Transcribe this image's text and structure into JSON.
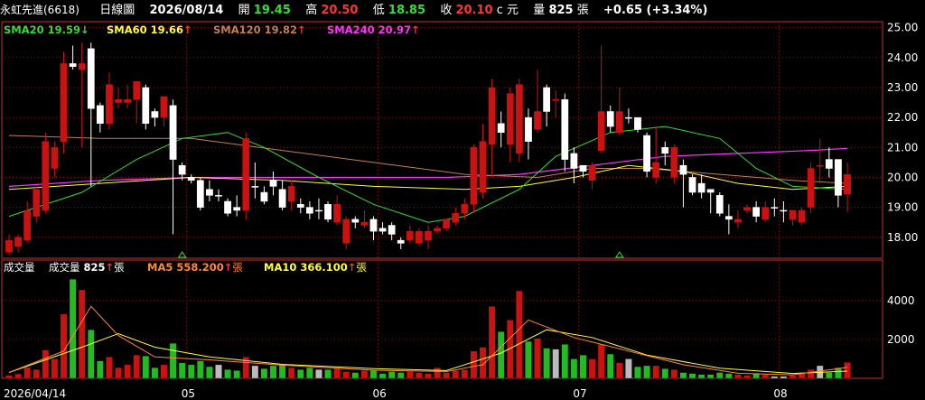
{
  "header": {
    "stock_name": "永虹先進(6618)",
    "chart_type": "日線圖",
    "date": "2026/08/14",
    "open_label": "開",
    "open": "19.45",
    "high_label": "高",
    "high": "20.50",
    "low_label": "低",
    "low": "18.85",
    "close_label": "收",
    "close": "20.10",
    "currency": "c 元",
    "volume_label": "量",
    "volume": "825",
    "volume_unit": "張",
    "change": "+0.65 (+3.34%)"
  },
  "ma_legend": [
    {
      "label": "SMA20 19.59",
      "arrow": "↓",
      "color": "#33dd33"
    },
    {
      "label": "SMA60 19.66",
      "arrow": "↑",
      "color": "#ffff33"
    },
    {
      "label": "SMA120 19.82",
      "arrow": "↑",
      "color": "#c08050"
    },
    {
      "label": "SMA240 20.97",
      "arrow": "↑",
      "color": "#ff33ff"
    }
  ],
  "volume_legend": {
    "title": "成交量",
    "vol_label": "成交量",
    "vol_value": "825",
    "vol_unit": "張",
    "ma5_label": "MA5 558.200",
    "ma5_unit": "張",
    "ma10_label": "MA10 366.100",
    "ma10_unit": "張"
  },
  "price_ticks": [
    "25.00",
    "24.00",
    "23.00",
    "22.00",
    "21.00",
    "20.00",
    "19.00",
    "18.00"
  ],
  "volume_ticks": [
    "4000",
    "2000"
  ],
  "date_labels": [
    "2026/04/14",
    "05",
    "06",
    "07",
    "08"
  ],
  "colors": {
    "up": "#cc1111",
    "down": "#ffffff",
    "green_vol": "#22bb22",
    "sma20": "#33dd33",
    "sma60": "#ffff33",
    "sma120": "#c08050",
    "sma240": "#ff33ff"
  },
  "chart_data": {
    "type": "candlestick",
    "ylim": [
      17.3,
      25.2
    ],
    "vol_ylim": [
      0,
      5200
    ],
    "candles": [
      [
        17.9,
        17.5,
        18.1,
        17.4,
        150,
        "up"
      ],
      [
        17.7,
        18.0,
        18.1,
        17.5,
        230,
        "up"
      ],
      [
        17.9,
        18.9,
        19.2,
        17.8,
        560,
        "up"
      ],
      [
        18.7,
        19.6,
        19.7,
        18.5,
        450,
        "up"
      ],
      [
        18.9,
        21.2,
        21.5,
        18.8,
        1450,
        "up"
      ],
      [
        20.3,
        21.0,
        21.2,
        20.0,
        1000,
        "up"
      ],
      [
        21.2,
        23.8,
        24.2,
        20.8,
        3300,
        "up"
      ],
      [
        23.7,
        23.8,
        24.4,
        23.6,
        5100,
        "down"
      ],
      [
        23.8,
        23.6,
        24.5,
        21.0,
        4550,
        "up"
      ],
      [
        24.3,
        22.3,
        24.5,
        19.7,
        2500,
        "down"
      ],
      [
        22.4,
        21.8,
        22.5,
        21.5,
        900,
        "down"
      ],
      [
        21.8,
        23.1,
        23.5,
        21.6,
        1100,
        "up"
      ],
      [
        22.6,
        22.5,
        23.0,
        22.3,
        550,
        "up"
      ],
      [
        22.5,
        22.6,
        23.1,
        22.3,
        700,
        "up"
      ],
      [
        22.6,
        23.2,
        23.2,
        21.8,
        1200,
        "up"
      ],
      [
        23.0,
        21.8,
        23.1,
        21.6,
        1150,
        "down"
      ],
      [
        22.2,
        22.0,
        22.3,
        21.7,
        550,
        "down"
      ],
      [
        22.0,
        22.7,
        22.7,
        21.7,
        700,
        "up"
      ],
      [
        22.4,
        20.6,
        22.6,
        18.1,
        1800,
        "down"
      ],
      [
        20.4,
        20.1,
        20.5,
        19.9,
        800,
        "down"
      ],
      [
        20.0,
        19.9,
        20.1,
        19.8,
        700,
        "down"
      ],
      [
        19.9,
        19.0,
        20.0,
        18.9,
        900,
        "down"
      ],
      [
        19.6,
        19.4,
        19.9,
        19.2,
        600,
        "down"
      ],
      [
        19.4,
        19.4,
        19.6,
        19.2,
        700,
        "down"
      ],
      [
        19.2,
        18.8,
        19.3,
        18.7,
        450,
        "down"
      ],
      [
        18.9,
        19.0,
        19.4,
        18.7,
        400,
        "down"
      ],
      [
        18.9,
        21.3,
        21.5,
        18.6,
        1100,
        "up"
      ],
      [
        19.7,
        19.7,
        20.5,
        19.3,
        650,
        "down"
      ],
      [
        19.5,
        19.2,
        19.7,
        19.1,
        500,
        "down"
      ],
      [
        19.9,
        19.7,
        20.2,
        19.4,
        650,
        "down"
      ],
      [
        19.6,
        19.0,
        19.9,
        18.9,
        700,
        "down"
      ],
      [
        19.2,
        19.7,
        19.9,
        18.9,
        550,
        "up"
      ],
      [
        19.1,
        19.0,
        19.3,
        18.8,
        450,
        "down"
      ],
      [
        19.0,
        18.8,
        19.2,
        18.6,
        550,
        "down"
      ],
      [
        18.9,
        18.9,
        19.3,
        18.6,
        450,
        "down"
      ],
      [
        19.1,
        18.6,
        19.2,
        18.5,
        450,
        "down"
      ],
      [
        18.5,
        19.1,
        19.4,
        18.4,
        550,
        "up"
      ],
      [
        17.8,
        18.6,
        18.7,
        17.6,
        350,
        "up"
      ],
      [
        18.6,
        18.5,
        18.7,
        18.3,
        300,
        "down"
      ],
      [
        18.4,
        18.5,
        18.9,
        18.3,
        400,
        "up"
      ],
      [
        18.6,
        18.2,
        18.7,
        17.9,
        400,
        "down"
      ],
      [
        18.3,
        18.2,
        18.5,
        18.1,
        250,
        "down"
      ],
      [
        18.4,
        18.1,
        18.5,
        17.9,
        350,
        "down"
      ],
      [
        17.9,
        17.8,
        18.0,
        17.6,
        300,
        "down"
      ],
      [
        17.9,
        18.2,
        18.4,
        17.8,
        350,
        "up"
      ],
      [
        17.8,
        18.2,
        18.3,
        17.7,
        300,
        "up"
      ],
      [
        17.9,
        18.2,
        18.4,
        17.6,
        250,
        "up"
      ],
      [
        18.2,
        18.3,
        18.4,
        18.1,
        550,
        "up"
      ],
      [
        18.3,
        18.6,
        18.6,
        18.2,
        300,
        "up"
      ],
      [
        18.5,
        18.8,
        19.0,
        18.4,
        400,
        "up"
      ],
      [
        18.8,
        19.1,
        19.3,
        18.6,
        450,
        "up"
      ],
      [
        19.1,
        21.0,
        21.1,
        18.8,
        1400,
        "up"
      ],
      [
        19.5,
        21.2,
        21.8,
        19.3,
        1600,
        "up"
      ],
      [
        21.1,
        23.0,
        23.3,
        20.0,
        3700,
        "up"
      ],
      [
        21.8,
        21.5,
        22.2,
        21.0,
        2400,
        "down"
      ],
      [
        22.8,
        21.1,
        23.0,
        20.5,
        3000,
        "up"
      ],
      [
        20.8,
        23.1,
        23.3,
        20.5,
        4500,
        "up"
      ],
      [
        22.0,
        21.2,
        22.3,
        20.6,
        1900,
        "down"
      ],
      [
        21.6,
        22.2,
        23.6,
        21.5,
        2050,
        "up"
      ],
      [
        23.0,
        22.2,
        23.1,
        21.7,
        1550,
        "down"
      ],
      [
        22.6,
        22.6,
        22.9,
        22.0,
        1500,
        "up"
      ],
      [
        22.6,
        20.6,
        22.8,
        20.2,
        1750,
        "down"
      ],
      [
        20.8,
        20.3,
        21.0,
        19.8,
        1000,
        "down"
      ],
      [
        20.2,
        20.4,
        20.4,
        20.0,
        1200,
        "down"
      ],
      [
        19.9,
        20.4,
        20.5,
        19.6,
        1000,
        "up"
      ],
      [
        20.9,
        22.2,
        24.4,
        20.8,
        1750,
        "up"
      ],
      [
        22.2,
        21.7,
        22.4,
        21.5,
        1250,
        "down"
      ],
      [
        21.5,
        22.2,
        23.0,
        21.4,
        800,
        "up"
      ],
      [
        22.0,
        22.0,
        22.3,
        21.8,
        1000,
        "down"
      ],
      [
        22.0,
        21.6,
        22.0,
        21.5,
        600,
        "down"
      ],
      [
        21.4,
        20.2,
        21.5,
        20.0,
        650,
        "down"
      ],
      [
        20.5,
        20.0,
        21.7,
        19.8,
        650,
        "up"
      ],
      [
        21.0,
        20.8,
        21.2,
        20.4,
        500,
        "down"
      ],
      [
        21.0,
        20.0,
        21.1,
        19.8,
        450,
        "up"
      ],
      [
        20.4,
        20.1,
        20.6,
        19.0,
        300,
        "down"
      ],
      [
        20.0,
        19.5,
        20.1,
        19.4,
        250,
        "down"
      ],
      [
        19.8,
        19.5,
        20.1,
        19.3,
        200,
        "down"
      ],
      [
        19.5,
        19.6,
        19.6,
        18.8,
        200,
        "down"
      ],
      [
        19.4,
        18.8,
        19.5,
        18.7,
        300,
        "down"
      ],
      [
        18.7,
        18.6,
        19.1,
        18.1,
        250,
        "down"
      ],
      [
        18.6,
        18.5,
        18.9,
        18.3,
        200,
        "up"
      ],
      [
        18.9,
        19.0,
        19.1,
        18.8,
        150,
        "up"
      ],
      [
        19.0,
        18.7,
        19.2,
        18.5,
        250,
        "down"
      ],
      [
        18.6,
        19.0,
        19.2,
        18.5,
        200,
        "up"
      ],
      [
        19.0,
        19.0,
        19.3,
        18.7,
        100,
        "down"
      ],
      [
        18.9,
        18.9,
        19.2,
        18.5,
        100,
        "down"
      ],
      [
        18.9,
        18.6,
        18.9,
        18.4,
        150,
        "up"
      ],
      [
        18.5,
        18.9,
        19.0,
        18.4,
        250,
        "up"
      ],
      [
        19.0,
        20.3,
        20.5,
        18.8,
        450,
        "up"
      ],
      [
        20.4,
        20.4,
        21.3,
        19.8,
        650,
        "up"
      ],
      [
        20.6,
        20.3,
        21.0,
        20.0,
        300,
        "down"
      ],
      [
        20.6,
        19.4,
        20.6,
        19.0,
        550,
        "down"
      ],
      [
        19.45,
        20.1,
        20.5,
        18.85,
        825,
        "up"
      ]
    ],
    "sma20": [
      [
        0,
        18.7
      ],
      [
        8,
        19.5
      ],
      [
        14,
        20.6
      ],
      [
        19,
        21.3
      ],
      [
        24,
        21.5
      ],
      [
        28,
        21.0
      ],
      [
        34,
        20.0
      ],
      [
        40,
        19.1
      ],
      [
        46,
        18.5
      ],
      [
        50,
        18.7
      ],
      [
        56,
        19.6
      ],
      [
        60,
        20.7
      ],
      [
        66,
        21.5
      ],
      [
        72,
        21.7
      ],
      [
        78,
        21.3
      ],
      [
        82,
        20.3
      ],
      [
        86,
        19.7
      ],
      [
        92,
        19.6
      ]
    ],
    "sma60": [
      [
        0,
        19.6
      ],
      [
        10,
        19.8
      ],
      [
        20,
        20.0
      ],
      [
        30,
        19.9
      ],
      [
        40,
        19.7
      ],
      [
        50,
        19.6
      ],
      [
        56,
        19.7
      ],
      [
        62,
        20.0
      ],
      [
        68,
        20.4
      ],
      [
        74,
        20.2
      ],
      [
        80,
        19.8
      ],
      [
        86,
        19.6
      ],
      [
        92,
        19.7
      ]
    ],
    "sma120": [
      [
        0,
        21.4
      ],
      [
        10,
        21.3
      ],
      [
        20,
        21.3
      ],
      [
        30,
        20.9
      ],
      [
        40,
        20.5
      ],
      [
        50,
        20.1
      ],
      [
        58,
        20.0
      ],
      [
        64,
        20.3
      ],
      [
        70,
        20.3
      ],
      [
        78,
        20.1
      ],
      [
        86,
        19.9
      ],
      [
        92,
        19.8
      ]
    ],
    "sma240": [
      [
        0,
        19.7
      ],
      [
        10,
        19.9
      ],
      [
        20,
        20.0
      ],
      [
        30,
        20.0
      ],
      [
        40,
        20.0
      ],
      [
        48,
        20.0
      ],
      [
        56,
        20.1
      ],
      [
        64,
        20.4
      ],
      [
        72,
        20.7
      ],
      [
        80,
        20.8
      ],
      [
        88,
        20.9
      ],
      [
        92,
        20.97
      ]
    ],
    "vol_ma5": [
      [
        0,
        300
      ],
      [
        6,
        1400
      ],
      [
        9,
        3700
      ],
      [
        12,
        2200
      ],
      [
        16,
        1100
      ],
      [
        22,
        950
      ],
      [
        30,
        680
      ],
      [
        40,
        420
      ],
      [
        48,
        350
      ],
      [
        52,
        700
      ],
      [
        57,
        3000
      ],
      [
        62,
        2100
      ],
      [
        68,
        1400
      ],
      [
        74,
        700
      ],
      [
        80,
        260
      ],
      [
        86,
        180
      ],
      [
        92,
        560
      ]
    ],
    "vol_ma10": [
      [
        0,
        300
      ],
      [
        8,
        1600
      ],
      [
        12,
        2300
      ],
      [
        16,
        1600
      ],
      [
        22,
        1100
      ],
      [
        30,
        720
      ],
      [
        40,
        500
      ],
      [
        48,
        400
      ],
      [
        54,
        1300
      ],
      [
        59,
        2500
      ],
      [
        64,
        2100
      ],
      [
        70,
        1200
      ],
      [
        78,
        520
      ],
      [
        86,
        250
      ],
      [
        92,
        370
      ]
    ]
  }
}
